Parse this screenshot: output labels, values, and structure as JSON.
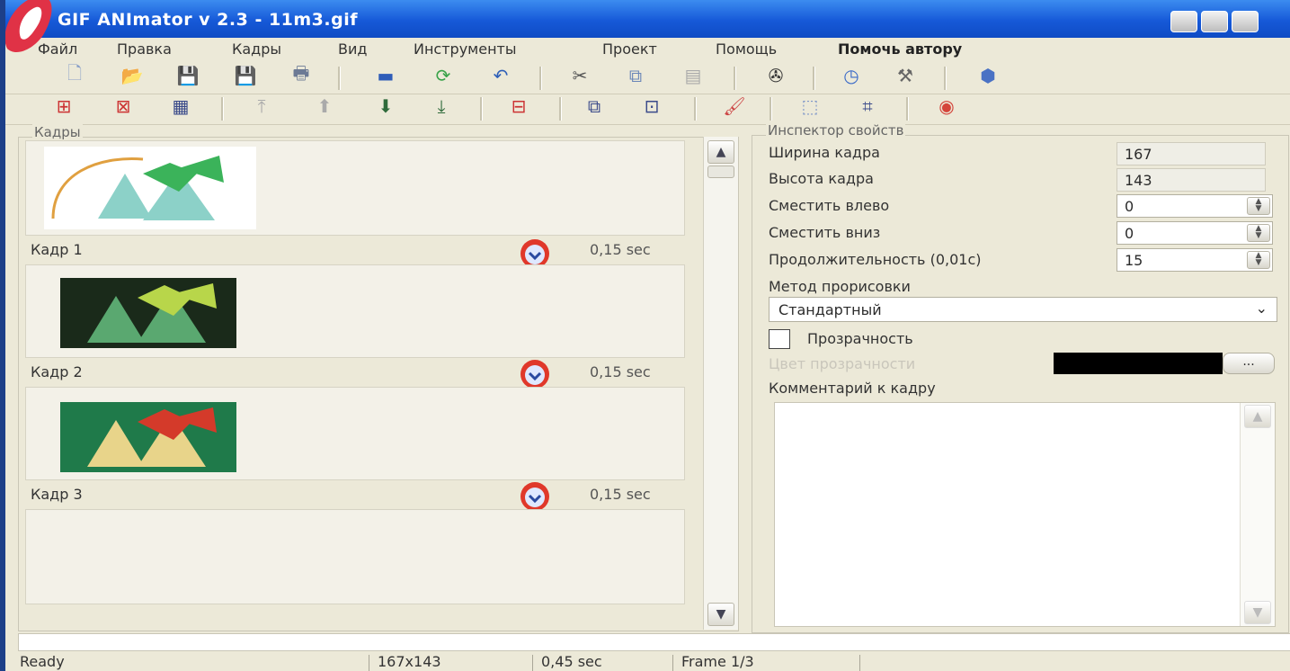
{
  "window": {
    "title": "GIF ANImator v 2.3 - 11m3.gif"
  },
  "menu": [
    "Файл",
    "Правка",
    "Кадры",
    "Вид",
    "Инструменты",
    "Проект",
    "Помощь",
    "Помочь автору"
  ],
  "frames_panel": {
    "label": "Кадры"
  },
  "frames": [
    {
      "label": "Кадр 1",
      "delay": "0,15 sec",
      "thumb_colors": [
        "#3bb35a",
        "#8cd1c8"
      ]
    },
    {
      "label": "Кадр 2",
      "delay": "0,15 sec",
      "thumb_colors": [
        "#b8d64a",
        "#5aa870"
      ]
    },
    {
      "label": "Кадр 3",
      "delay": "0,15 sec",
      "thumb_colors": [
        "#d43a2a",
        "#e8d48a"
      ]
    }
  ],
  "inspector": {
    "label": "Инспектор свойств",
    "width_label": "Ширина кадра",
    "width_value": "167",
    "height_label": "Высота кадра",
    "height_value": "143",
    "offset_left_label": "Сместить влево",
    "offset_left_value": "0",
    "offset_down_label": "Сместить вниз",
    "offset_down_value": "0",
    "duration_label": "Продолжительность (0,01c)",
    "duration_value": "15",
    "method_label": "Метод прорисовки",
    "method_value": "Стандартный",
    "transparency_label": "Прозрачность",
    "transparency_color_label": "Цвет прозрачности",
    "transparency_color": "#000000",
    "comment_label": "Комментарий к кадру",
    "color_button_label": "..."
  },
  "status": {
    "text": "Ready",
    "size": "167x143",
    "total": "0,45 sec",
    "frame": "Frame 1/3"
  },
  "colors": {
    "titlebar": "#1659d8",
    "window_bg": "#ece9d8",
    "accent_red": "#e0382a"
  }
}
